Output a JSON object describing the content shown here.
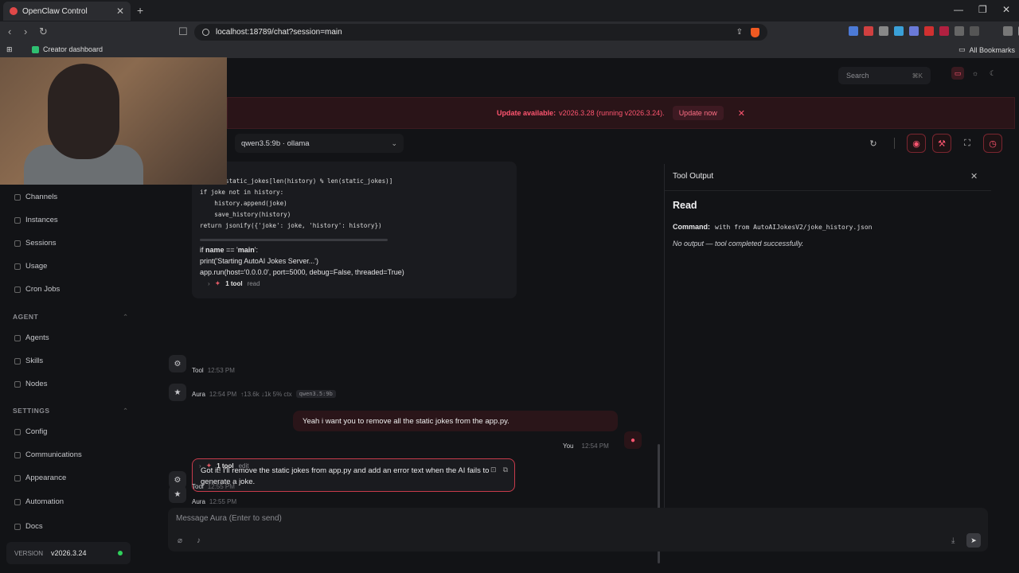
{
  "browser": {
    "tab_title": "OpenClaw Control",
    "url": "localhost:18789/chat?session=main",
    "bookmark": "Creator dashboard",
    "all_bookmarks": "All Bookmarks"
  },
  "topbar": {
    "search_placeholder": "Search",
    "search_shortcut": "⌘K"
  },
  "banner": {
    "label": "Update available:",
    "detail": "v2026.3.28 (running v2026.3.24).",
    "button": "Update now"
  },
  "sidebar": {
    "items_top": [
      "Channels",
      "Instances",
      "Sessions",
      "Usage",
      "Cron Jobs"
    ],
    "agent_section": "AGENT",
    "items_agent": [
      "Agents",
      "Skills",
      "Nodes"
    ],
    "settings_section": "SETTINGS",
    "items_settings": [
      "Config",
      "Communications",
      "Appearance",
      "Automation"
    ],
    "docs": "Docs",
    "version_label": "VERSION",
    "version_value": "v2026.3.24"
  },
  "chat": {
    "model": "qwen3.5:9b · ollama",
    "code_lines": [
      "joke = static_jokes[len(history) % len(static_jokes)]",
      "if joke not in history:",
      "    history.append(joke)",
      "    save_history(history)",
      "return jsonify({'joke': joke, 'history': history})"
    ],
    "prose_if": "if ",
    "prose_name": "name",
    "prose_eq": " == '",
    "prose_main": "main",
    "prose_end": "':",
    "prose_line2": "print('Starting AutoAI Jokes Server...')",
    "prose_line3": "app.run(host='0.0.0.0', port=5000, debug=False, threaded=True)",
    "tool1_count": "1 tool",
    "tool1_kind": "read",
    "tool_label_1": "Tool",
    "tool_time_1": "12:53 PM",
    "aura_name": "Aura",
    "aura_time_1": "12:54 PM",
    "aura_stats": "↑13.6k ↓1k 5% ctx",
    "aura_model_chip": "qwen3.5:9b",
    "user_message": "Yeah i want you to remove all the static jokes from the app.py.",
    "user_name": "You",
    "user_time": "12:54 PM",
    "ai_message": "Got it! I'll remove the static jokes from app.py and add an error text when the AI fails to generate a joke.",
    "aura_time_2": "12:55 PM",
    "tool2_count": "1 tool",
    "tool2_kind": "edit",
    "tool_label_2": "Tool",
    "tool_time_2": "12:55 PM"
  },
  "tool_output": {
    "title": "Tool Output",
    "heading": "Read",
    "command_label": "Command:",
    "command_value": "with from AutoAIJokesV2/joke_history.json",
    "result": "No output — tool completed successfully."
  },
  "composer": {
    "placeholder": "Message Aura (Enter to send)"
  }
}
